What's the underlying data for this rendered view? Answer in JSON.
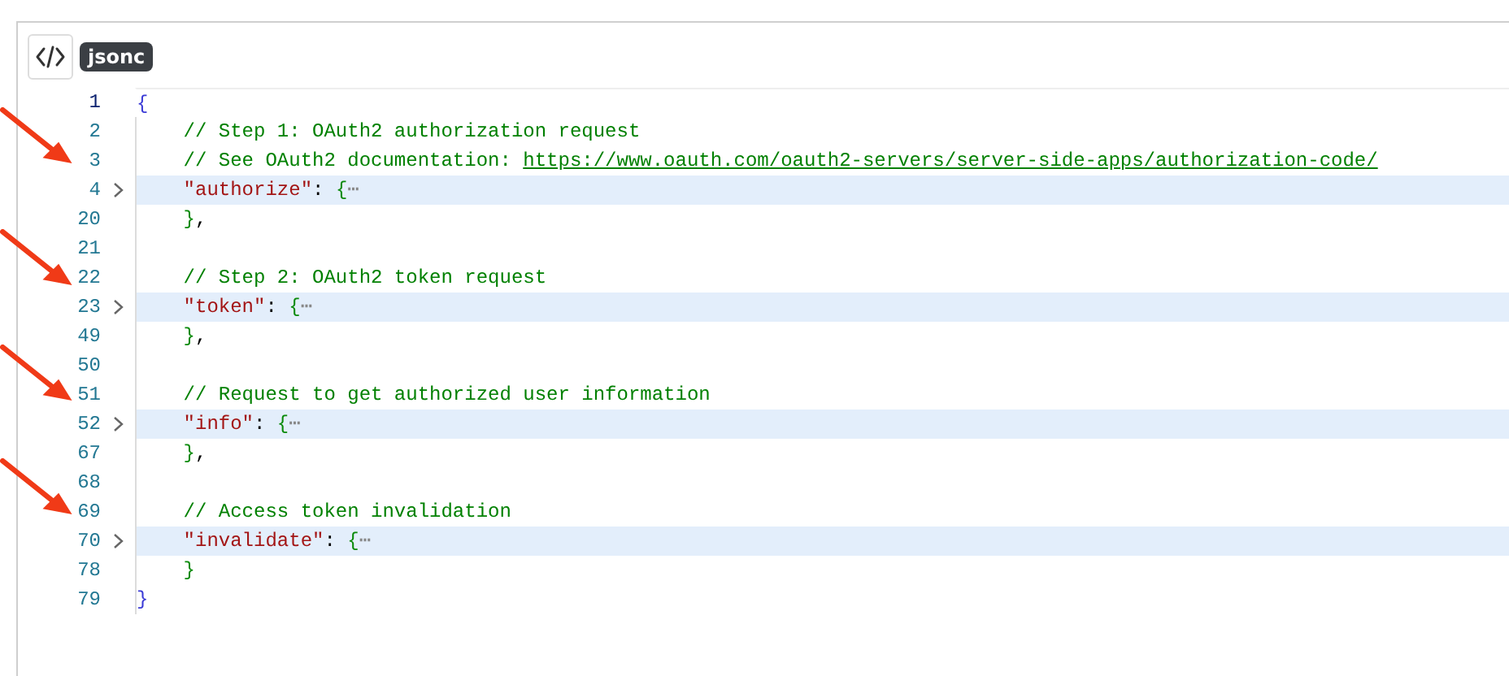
{
  "toolbar": {
    "language": "jsonc"
  },
  "lines": [
    {
      "number": "1",
      "active": true,
      "folded": false,
      "tokens": [
        {
          "kind": "root",
          "text": "{"
        }
      ]
    },
    {
      "number": "2",
      "active": false,
      "folded": false,
      "tokens": [
        {
          "kind": "comment",
          "text": "    // Step 1: OAuth2 authorization request"
        }
      ]
    },
    {
      "number": "3",
      "active": false,
      "folded": false,
      "tokens": [
        {
          "kind": "comment",
          "text": "    // See OAuth2 documentation: "
        },
        {
          "kind": "link",
          "text": "https://www.oauth.com/oauth2-servers/server-side-apps/authorization-code/"
        }
      ]
    },
    {
      "number": "4",
      "active": false,
      "folded": true,
      "tokens": [
        {
          "kind": "key",
          "text": "    \"authorize\""
        },
        {
          "kind": "punct",
          "text": ": "
        },
        {
          "kind": "brace",
          "text": "{"
        },
        {
          "kind": "fold",
          "text": "⋯"
        }
      ]
    },
    {
      "number": "20",
      "active": false,
      "folded": false,
      "tokens": [
        {
          "kind": "brace",
          "text": "    }"
        },
        {
          "kind": "punct",
          "text": ","
        }
      ]
    },
    {
      "number": "21",
      "active": false,
      "folded": false
    },
    {
      "number": "22",
      "active": false,
      "folded": false,
      "tokens": [
        {
          "kind": "comment",
          "text": "    // Step 2: OAuth2 token request"
        }
      ]
    },
    {
      "number": "23",
      "active": false,
      "folded": true,
      "tokens": [
        {
          "kind": "key",
          "text": "    \"token\""
        },
        {
          "kind": "punct",
          "text": ": "
        },
        {
          "kind": "brace",
          "text": "{"
        },
        {
          "kind": "fold",
          "text": "⋯"
        }
      ]
    },
    {
      "number": "49",
      "active": false,
      "folded": false,
      "tokens": [
        {
          "kind": "brace",
          "text": "    }"
        },
        {
          "kind": "punct",
          "text": ","
        }
      ]
    },
    {
      "number": "50",
      "active": false,
      "folded": false
    },
    {
      "number": "51",
      "active": false,
      "folded": false,
      "tokens": [
        {
          "kind": "comment",
          "text": "    // Request to get authorized user information"
        }
      ]
    },
    {
      "number": "52",
      "active": false,
      "folded": true,
      "tokens": [
        {
          "kind": "key",
          "text": "    \"info\""
        },
        {
          "kind": "punct",
          "text": ": "
        },
        {
          "kind": "brace",
          "text": "{"
        },
        {
          "kind": "fold",
          "text": "⋯"
        }
      ]
    },
    {
      "number": "67",
      "active": false,
      "folded": false,
      "tokens": [
        {
          "kind": "brace",
          "text": "    }"
        },
        {
          "kind": "punct",
          "text": ","
        }
      ]
    },
    {
      "number": "68",
      "active": false,
      "folded": false
    },
    {
      "number": "69",
      "active": false,
      "folded": false,
      "tokens": [
        {
          "kind": "comment",
          "text": "    // Access token invalidation"
        }
      ]
    },
    {
      "number": "70",
      "active": false,
      "folded": true,
      "tokens": [
        {
          "kind": "key",
          "text": "    \"invalidate\""
        },
        {
          "kind": "punct",
          "text": ": "
        },
        {
          "kind": "brace",
          "text": "{"
        },
        {
          "kind": "fold",
          "text": "⋯"
        }
      ]
    },
    {
      "number": "78",
      "active": false,
      "folded": false,
      "tokens": [
        {
          "kind": "brace",
          "text": "    }"
        }
      ]
    },
    {
      "number": "79",
      "active": false,
      "folded": false,
      "tokens": [
        {
          "kind": "root",
          "text": "}"
        }
      ]
    }
  ]
}
